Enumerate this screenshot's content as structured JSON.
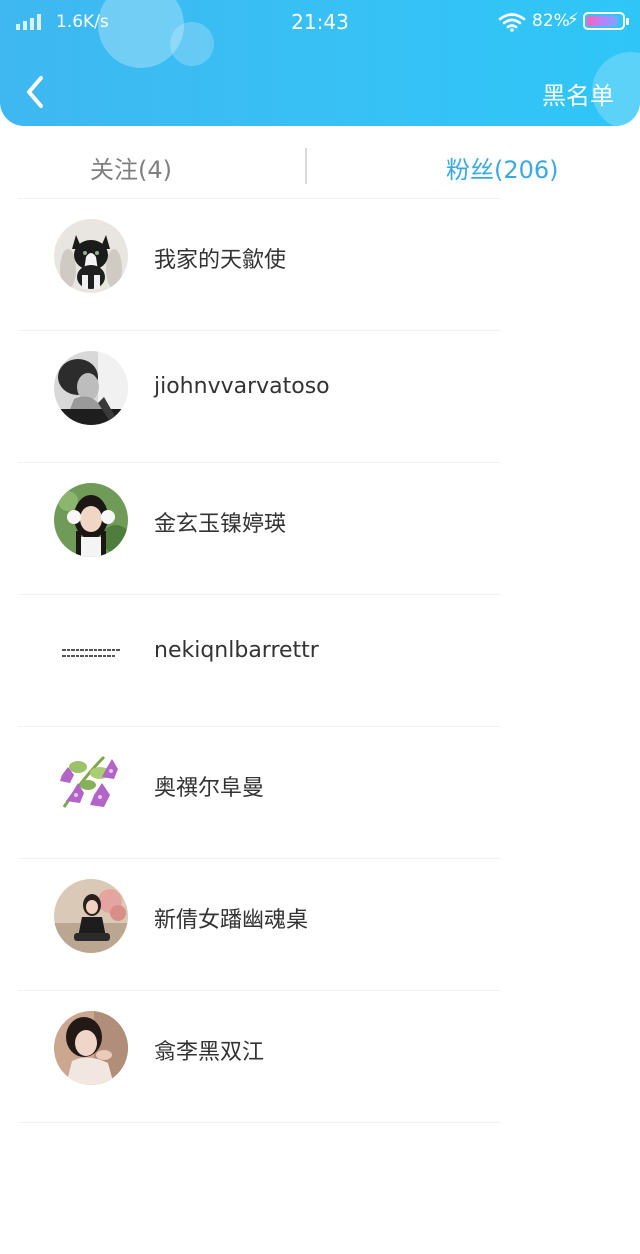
{
  "status_bar": {
    "net_speed": "1.6K/s",
    "time": "21:43",
    "battery": "82%"
  },
  "header": {
    "blacklist_label": "黑名单"
  },
  "tabs": [
    {
      "label": "关注(4)",
      "active": false
    },
    {
      "label": "粉丝(206)",
      "active": true
    }
  ],
  "fans": [
    {
      "name": "我家的天歙使",
      "avatar": "kitten-avatar"
    },
    {
      "name": "jiohnvvarvatoso",
      "avatar": "man-portrait-avatar"
    },
    {
      "name": "金玄玉镍婷瑛",
      "avatar": "girl-earmuffs-avatar"
    },
    {
      "name": "nekiqnlbarrettr",
      "avatar": "text-note-avatar"
    },
    {
      "name": "奥禩尔阜曼",
      "avatar": "purple-flowers-avatar"
    },
    {
      "name": "新倩女蹯幽魂桌",
      "avatar": "girl-sitting-avatar"
    },
    {
      "name": "翕李黑双江",
      "avatar": "woman-portrait-avatar"
    }
  ],
  "colors": {
    "header": "#3fb7f0",
    "active_tab": "#3aa8e2",
    "inactive_tab": "#7f7f7f"
  }
}
